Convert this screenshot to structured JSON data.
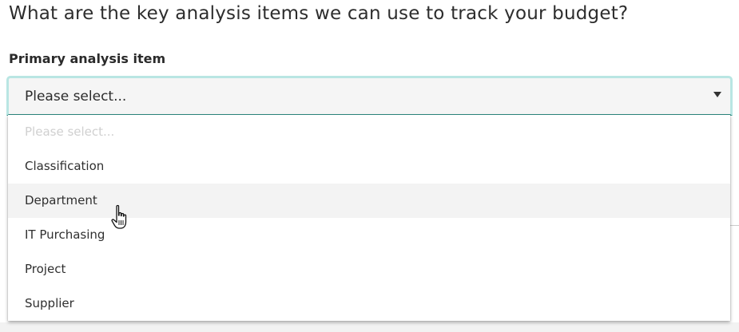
{
  "question": "What are the key analysis items we can use to track your budget?",
  "field": {
    "label": "Primary analysis item",
    "selected_value": "Please select..."
  },
  "dropdown": {
    "options": [
      {
        "label": "Please select...",
        "placeholder": true
      },
      {
        "label": "Classification"
      },
      {
        "label": "Department",
        "hovered": true
      },
      {
        "label": "IT Purchasing"
      },
      {
        "label": "Project"
      },
      {
        "label": "Supplier"
      }
    ]
  },
  "colors": {
    "focus_border": "#b9e6e3",
    "underline_accent": "#2f8f86",
    "hover_background": "#f3f3f3"
  },
  "icons": {
    "select_arrow": "caret-down-icon",
    "cursor": "hand-pointer-cursor-icon"
  }
}
